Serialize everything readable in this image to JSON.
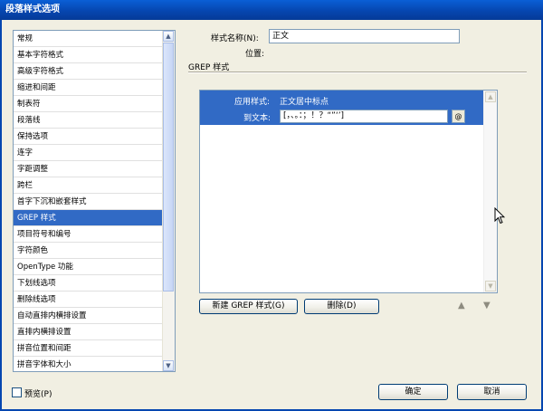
{
  "window": {
    "title": "段落样式选项"
  },
  "categories": {
    "items": [
      "常规",
      "基本字符格式",
      "高级字符格式",
      "缩进和间距",
      "制表符",
      "段落线",
      "保持选项",
      "连字",
      "字距调整",
      "跨栏",
      "首字下沉和嵌套样式",
      "GREP 样式",
      "项目符号和编号",
      "字符颜色",
      "OpenType 功能",
      "下划线选项",
      "删除线选项",
      "自动直排内横排设置",
      "直排内横排设置",
      "拼音位置和间距",
      "拼音字体和大小"
    ],
    "selected_index": 11
  },
  "style_name": {
    "label": "样式名称(N):",
    "value": "正文"
  },
  "location": {
    "label": "位置:"
  },
  "section": {
    "title": "GREP 样式"
  },
  "grep": {
    "apply_style_label": "应用样式:",
    "apply_style_value": "正文居中标点",
    "to_text_label": "到文本:",
    "to_text_value": "[，、。：；！？“”‘’]",
    "special_chars_button": "@"
  },
  "buttons": {
    "new_grep": "新建 GREP 样式(G)",
    "delete": "删除(D)",
    "ok": "确定",
    "cancel": "取消"
  },
  "arrows": {
    "up": "▲",
    "down": "▼"
  },
  "preview": {
    "label": "预览(P)",
    "checked": false
  },
  "colors": {
    "selection": "#316ac5",
    "titlebar": "#0646b0",
    "dialog_bg": "#f1efe2"
  }
}
